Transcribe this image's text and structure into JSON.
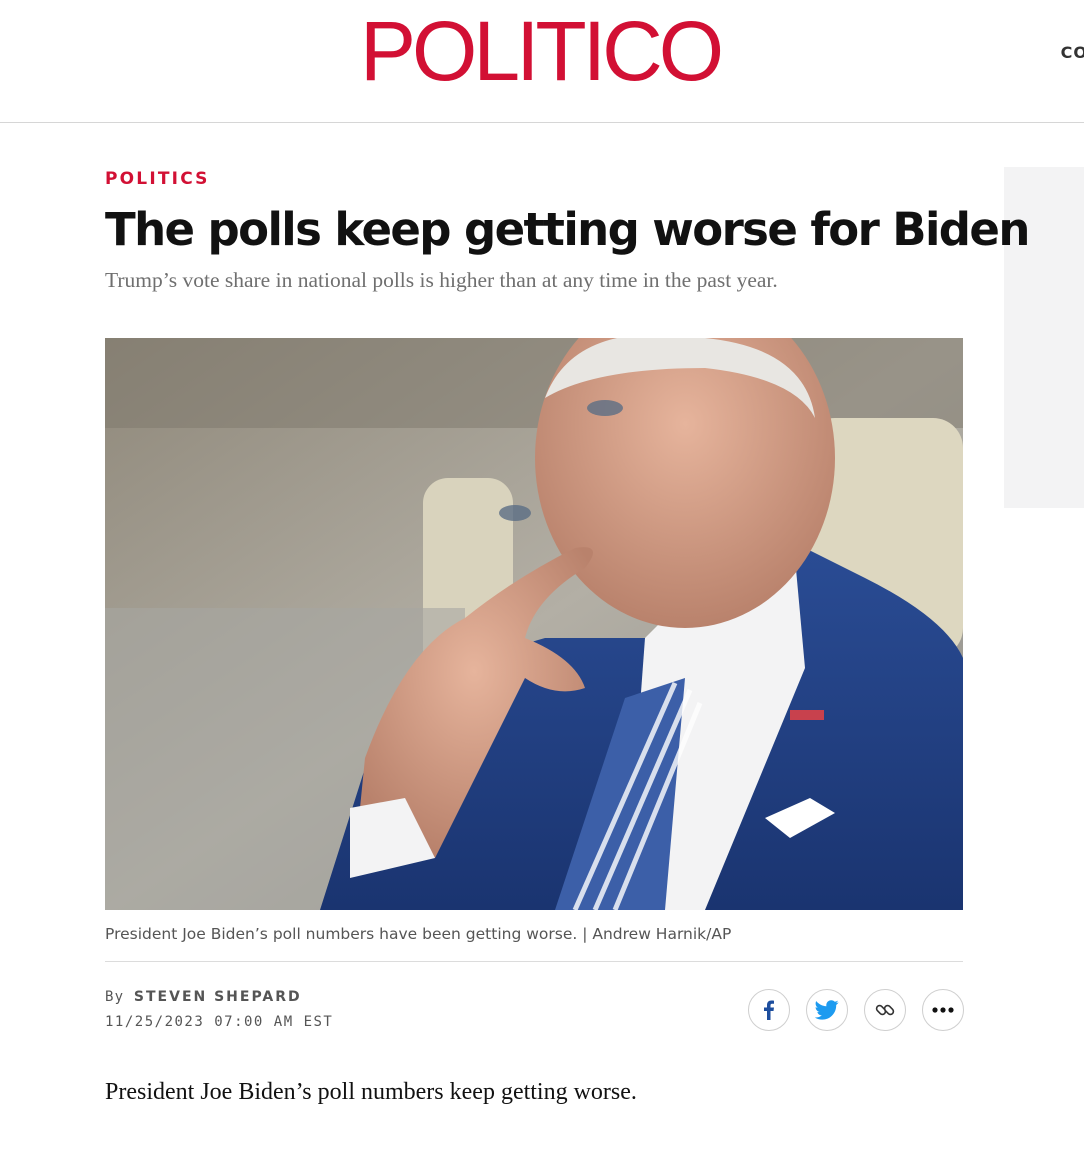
{
  "header": {
    "logo_text": "POLITICO",
    "edge_text": "CO"
  },
  "article": {
    "section": "POLITICS",
    "headline": "The polls keep getting worse for Biden",
    "dek": "Trump’s vote share in national polls is higher than at any time in the past year.",
    "photo_caption": "President Joe Biden’s poll numbers have been getting worse. | Andrew Harnik/AP",
    "byline_prefix": "By",
    "author": "STEVEN SHEPARD",
    "timestamp": "11/25/2023 07:00 AM EST",
    "first_paragraph": "President Joe Biden’s poll numbers keep getting worse."
  },
  "share": {
    "buttons": [
      {
        "icon": "facebook-icon",
        "color": "#1d4e9e"
      },
      {
        "icon": "twitter-icon",
        "color": "#1d9bf0"
      },
      {
        "icon": "link-icon",
        "color": "#333333"
      },
      {
        "icon": "more-icon",
        "color": "#111111"
      }
    ]
  },
  "colors": {
    "brand": "#d21034",
    "text": "#111111",
    "muted": "#6f6f6f"
  }
}
